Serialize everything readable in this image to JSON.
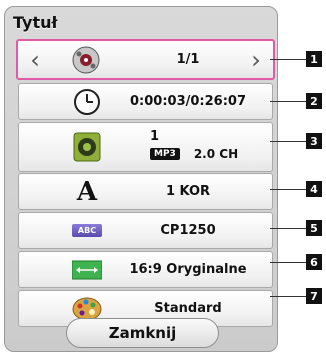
{
  "title": "Tytuł",
  "rows": [
    {
      "id": "1",
      "icon": "disc-chapter-icon",
      "value": "1/1"
    },
    {
      "id": "2",
      "icon": "clock-icon",
      "value": "0:00:03/0:26:07"
    },
    {
      "id": "3",
      "icon": "speaker-icon",
      "value_line1": "1",
      "badge": "MP3",
      "channels": "2.0 CH"
    },
    {
      "id": "4",
      "icon": "letter-a-icon",
      "icon_glyph": "A",
      "value": "1 KOR"
    },
    {
      "id": "5",
      "icon": "abc-tag-icon",
      "icon_glyph": "ABC",
      "value": "CP1250"
    },
    {
      "id": "6",
      "icon": "aspect-ratio-icon",
      "value": "16:9 Oryginalne"
    },
    {
      "id": "7",
      "icon": "palette-icon",
      "value": "Standard"
    }
  ],
  "nav": {
    "prev": "‹",
    "next": "›"
  },
  "close_label": "Zamknij",
  "accent": "#e05aa8"
}
